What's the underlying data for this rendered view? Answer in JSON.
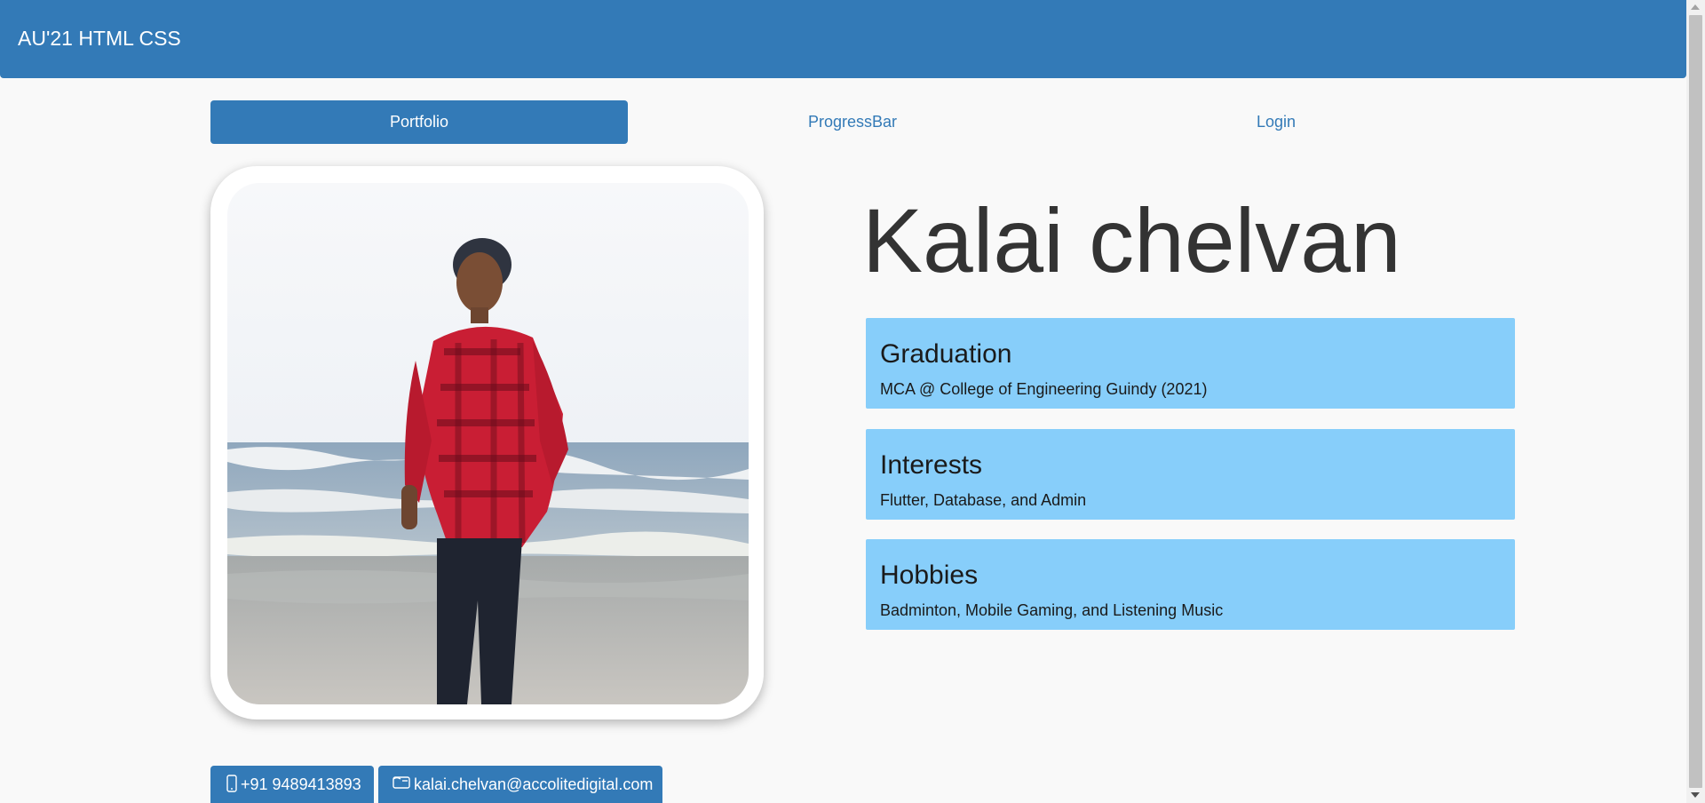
{
  "header": {
    "brand": "AU'21 HTML CSS",
    "color": "#337ab7"
  },
  "nav": {
    "items": [
      {
        "label": "Portfolio",
        "active": true
      },
      {
        "label": "ProgressBar",
        "active": false
      },
      {
        "label": "Login",
        "active": false
      }
    ]
  },
  "profile": {
    "name": "Kalai chelvan",
    "photo_icon": "profile-photo"
  },
  "cards": [
    {
      "title": "Graduation",
      "desc": "MCA @ College of Engineering Guindy (2021)"
    },
    {
      "title": "Interests",
      "desc": "Flutter, Database, and Admin"
    },
    {
      "title": "Hobbies",
      "desc": "Badminton, Mobile Gaming, and Listening Music"
    }
  ],
  "card_color": "#87cefa",
  "contacts": {
    "phone": {
      "icon": "phone-icon",
      "label": "+91 9489413893"
    },
    "email": {
      "icon": "email-icon",
      "label": "kalai.chelvan@accolitedigital.com"
    }
  }
}
